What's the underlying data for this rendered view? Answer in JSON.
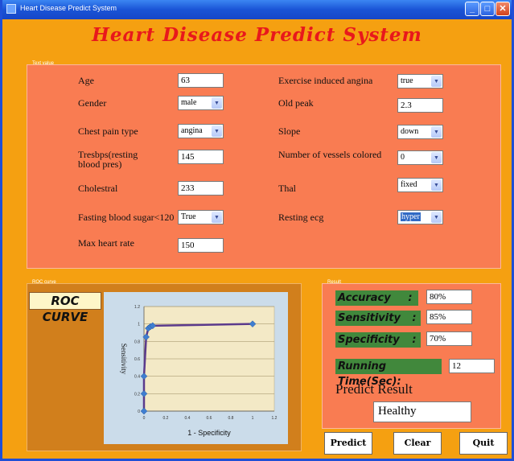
{
  "window": {
    "title": "Heart Disease Predict System",
    "min": "_",
    "max": "□",
    "close": "✕"
  },
  "app_title": "Heart Disease Predict System",
  "input_panel": {
    "legend": "Text value",
    "age": {
      "label": "Age",
      "value": "63"
    },
    "gender": {
      "label": "Gender",
      "value": "male"
    },
    "chest": {
      "label": "Chest pain type",
      "value": "angina"
    },
    "trestbps": {
      "label1": "Tresbps(resting",
      "label2": "blood pres)",
      "value": "145"
    },
    "chol": {
      "label": "Cholestral",
      "value": "233"
    },
    "fbs": {
      "label": "Fasting blood sugar<120",
      "value": "True"
    },
    "maxhr": {
      "label": "Max heart rate",
      "value": "150"
    },
    "exang": {
      "label": "Exercise induced angina",
      "value": "true"
    },
    "oldpeak": {
      "label": "Old peak",
      "value": "2.3"
    },
    "slope": {
      "label": "Slope",
      "value": "down"
    },
    "vessels": {
      "label": "Number of vessels colored",
      "value": "0"
    },
    "thal": {
      "label": "Thal",
      "value": "fixed"
    },
    "restecg": {
      "label": "Resting ecg",
      "value": "hyper"
    }
  },
  "roc_panel": {
    "legend": "ROC curve",
    "title": "ROC CURVE"
  },
  "chart_data": {
    "type": "line",
    "xlabel": "1 - Specificity",
    "ylabel": "Sensitivity",
    "xlim": [
      0,
      1.2
    ],
    "ylim": [
      0,
      1.2
    ],
    "xticks": [
      "0",
      "0.2",
      "0.4",
      "0.6",
      "0.8",
      "1",
      "1.2"
    ],
    "yticks": [
      "0",
      "0.2",
      "0.4",
      "0.6",
      "0.8",
      "1",
      "1.2"
    ],
    "points": [
      [
        0,
        0
      ],
      [
        0,
        0.2
      ],
      [
        0,
        0.4
      ],
      [
        0.02,
        0.85
      ],
      [
        0.04,
        0.95
      ],
      [
        0.06,
        0.97
      ],
      [
        0.08,
        0.98
      ],
      [
        1,
        1
      ]
    ],
    "line_color": "#5b3a8c",
    "marker_color": "#3f7ed0"
  },
  "result_panel": {
    "legend": "Result",
    "accuracy": {
      "label": "Accuracy",
      "colon": ":",
      "value": "80%"
    },
    "sensitivity": {
      "label": "Sensitivity",
      "colon": ":",
      "value": "85%"
    },
    "specificity": {
      "label": "Specificity",
      "colon": ":",
      "value": "70%"
    },
    "running_time": {
      "label": "Running Time(Sec):",
      "value": "12"
    },
    "predict_label": "Predict Result",
    "predict_value": "Healthy"
  },
  "buttons": {
    "predict": "Predict",
    "clear": "Clear",
    "quit": "Quit"
  }
}
